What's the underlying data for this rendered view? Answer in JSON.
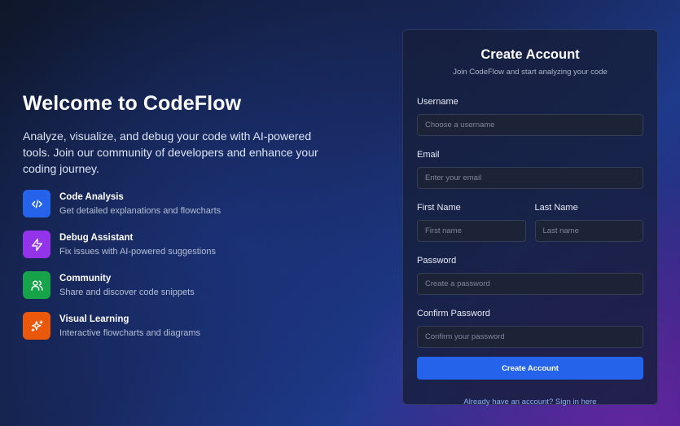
{
  "hero": {
    "title": "Welcome to CodeFlow",
    "description": "Analyze, visualize, and debug your code with AI-powered tools. Join our community of developers and enhance your coding journey."
  },
  "features": [
    {
      "icon": "code-icon",
      "color": "#2563eb",
      "title": "Code Analysis",
      "description": "Get detailed explanations and flowcharts"
    },
    {
      "icon": "lightning-icon",
      "color": "#9333ea",
      "title": "Debug Assistant",
      "description": "Fix issues with AI-powered suggestions"
    },
    {
      "icon": "users-icon",
      "color": "#16a34a",
      "title": "Community",
      "description": "Share and discover code snippets"
    },
    {
      "icon": "sparkles-icon",
      "color": "#ea580c",
      "title": "Visual Learning",
      "description": "Interactive flowcharts and diagrams"
    }
  ],
  "form": {
    "title": "Create Account",
    "subtitle": "Join CodeFlow and start analyzing your code",
    "username": {
      "label": "Username",
      "placeholder": "Choose a username",
      "value": ""
    },
    "email": {
      "label": "Email",
      "placeholder": "Enter your email",
      "value": ""
    },
    "first_name": {
      "label": "First Name",
      "placeholder": "First name",
      "value": ""
    },
    "last_name": {
      "label": "Last Name",
      "placeholder": "Last name",
      "value": ""
    },
    "password": {
      "label": "Password",
      "placeholder": "Create a password",
      "value": ""
    },
    "confirm_password": {
      "label": "Confirm Password",
      "placeholder": "Confirm your password",
      "value": ""
    },
    "submit_label": "Create Account",
    "signin_link": "Already have an account? Sign in here"
  },
  "colors": {
    "accent": "#2563eb",
    "link": "#8fb0f4"
  }
}
